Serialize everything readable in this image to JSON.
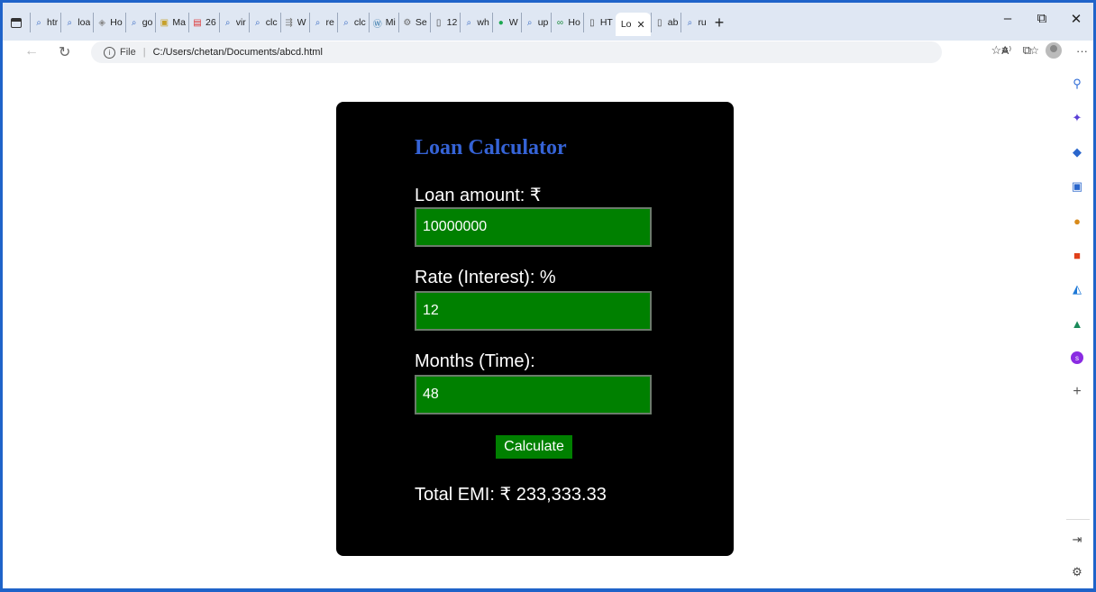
{
  "browser": {
    "tabs": [
      {
        "icon": "search",
        "label": "htr"
      },
      {
        "icon": "search",
        "label": "loa"
      },
      {
        "icon": "globe",
        "label": "Ho"
      },
      {
        "icon": "search",
        "label": "go"
      },
      {
        "icon": "image",
        "label": "Ma"
      },
      {
        "icon": "pdf",
        "label": "26"
      },
      {
        "icon": "search",
        "label": "vir"
      },
      {
        "icon": "search",
        "label": "clc"
      },
      {
        "icon": "arrow",
        "label": "W"
      },
      {
        "icon": "search",
        "label": "re"
      },
      {
        "icon": "search",
        "label": "clc"
      },
      {
        "icon": "wordpress",
        "label": "Mi"
      },
      {
        "icon": "gear",
        "label": "Se"
      },
      {
        "icon": "doc",
        "label": "12"
      },
      {
        "icon": "search",
        "label": "wh"
      },
      {
        "icon": "whatsapp",
        "label": "W"
      },
      {
        "icon": "search",
        "label": "up"
      },
      {
        "icon": "link",
        "label": "Ho"
      },
      {
        "icon": "doc",
        "label": "HT"
      }
    ],
    "active_tab": {
      "label": "Lo"
    },
    "tabs_after": [
      {
        "icon": "doc",
        "label": "ab"
      },
      {
        "icon": "search",
        "label": "ru"
      }
    ],
    "address": {
      "scheme_label": "File",
      "url": "C:/Users/chetan/Documents/abcd.html"
    },
    "omnibox_icons": {
      "read_aloud": "A⁾",
      "favorite": "☆"
    },
    "window_controls": {
      "minimize": "–",
      "restore": "⧉",
      "close": "✕"
    }
  },
  "calculator": {
    "title": "Loan Calculator",
    "amount_label": "Loan amount: ₹",
    "amount_value": "10000000",
    "rate_label": "Rate (Interest): %",
    "rate_value": "12",
    "months_label": "Months (Time):",
    "months_value": "48",
    "button_label": "Calculate",
    "result_text": "Total EMI: ₹ 233,333.33"
  },
  "colors": {
    "frame": "#1f63c9",
    "card_bg": "#000000",
    "title": "#3563d6",
    "input_bg": "#008000"
  }
}
